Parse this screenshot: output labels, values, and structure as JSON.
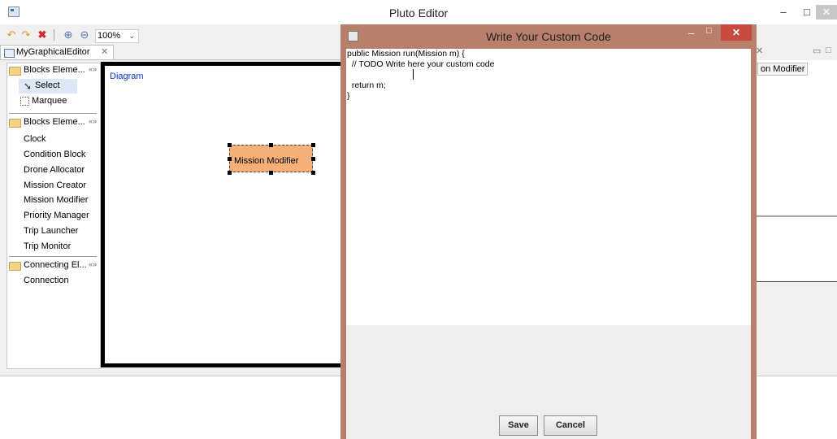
{
  "window": {
    "title": "Pluto Editor",
    "min_icon": "–",
    "max_icon": "□",
    "close_icon": "✕"
  },
  "toolbar": {
    "zoom": "100%",
    "icons": [
      "undo-icon",
      "redo-icon",
      "delete-icon",
      "zoom-in-icon",
      "zoom-out-icon"
    ]
  },
  "editor_tab": {
    "label": "MyGraphicalEditor",
    "close": "✕"
  },
  "palette": {
    "drawers": [
      {
        "label": "Blocks Eleme...",
        "items": [
          {
            "label": "Select"
          },
          {
            "label": "Marquee"
          }
        ]
      },
      {
        "label": "Blocks Eleme...",
        "items": [
          {
            "label": "Clock"
          },
          {
            "label": "Condition Block"
          },
          {
            "label": "Drone Allocator"
          },
          {
            "label": "Mission Creator"
          },
          {
            "label": "Mission Modifier"
          },
          {
            "label": "Priority Manager"
          },
          {
            "label": "Trip Launcher"
          },
          {
            "label": "Trip Monitor"
          }
        ]
      },
      {
        "label": "Connecting El...",
        "items": [
          {
            "label": "Connection"
          }
        ]
      }
    ],
    "chevron": "«»"
  },
  "canvas": {
    "title": "Diagram",
    "block_label": "Mission Modifier",
    "block_color": "#f5b07a"
  },
  "right_views": {
    "property_label": "on Modifier"
  },
  "dialog": {
    "title": "Write Your Custom Code",
    "code": "public Mission run(Mission m) {\n  // TODO Write here your custom code\n\n  return m;\n}",
    "save_label": "Save",
    "cancel_label": "Cancel",
    "frame_color": "#b87f6b",
    "close_color": "#c94b3f"
  }
}
